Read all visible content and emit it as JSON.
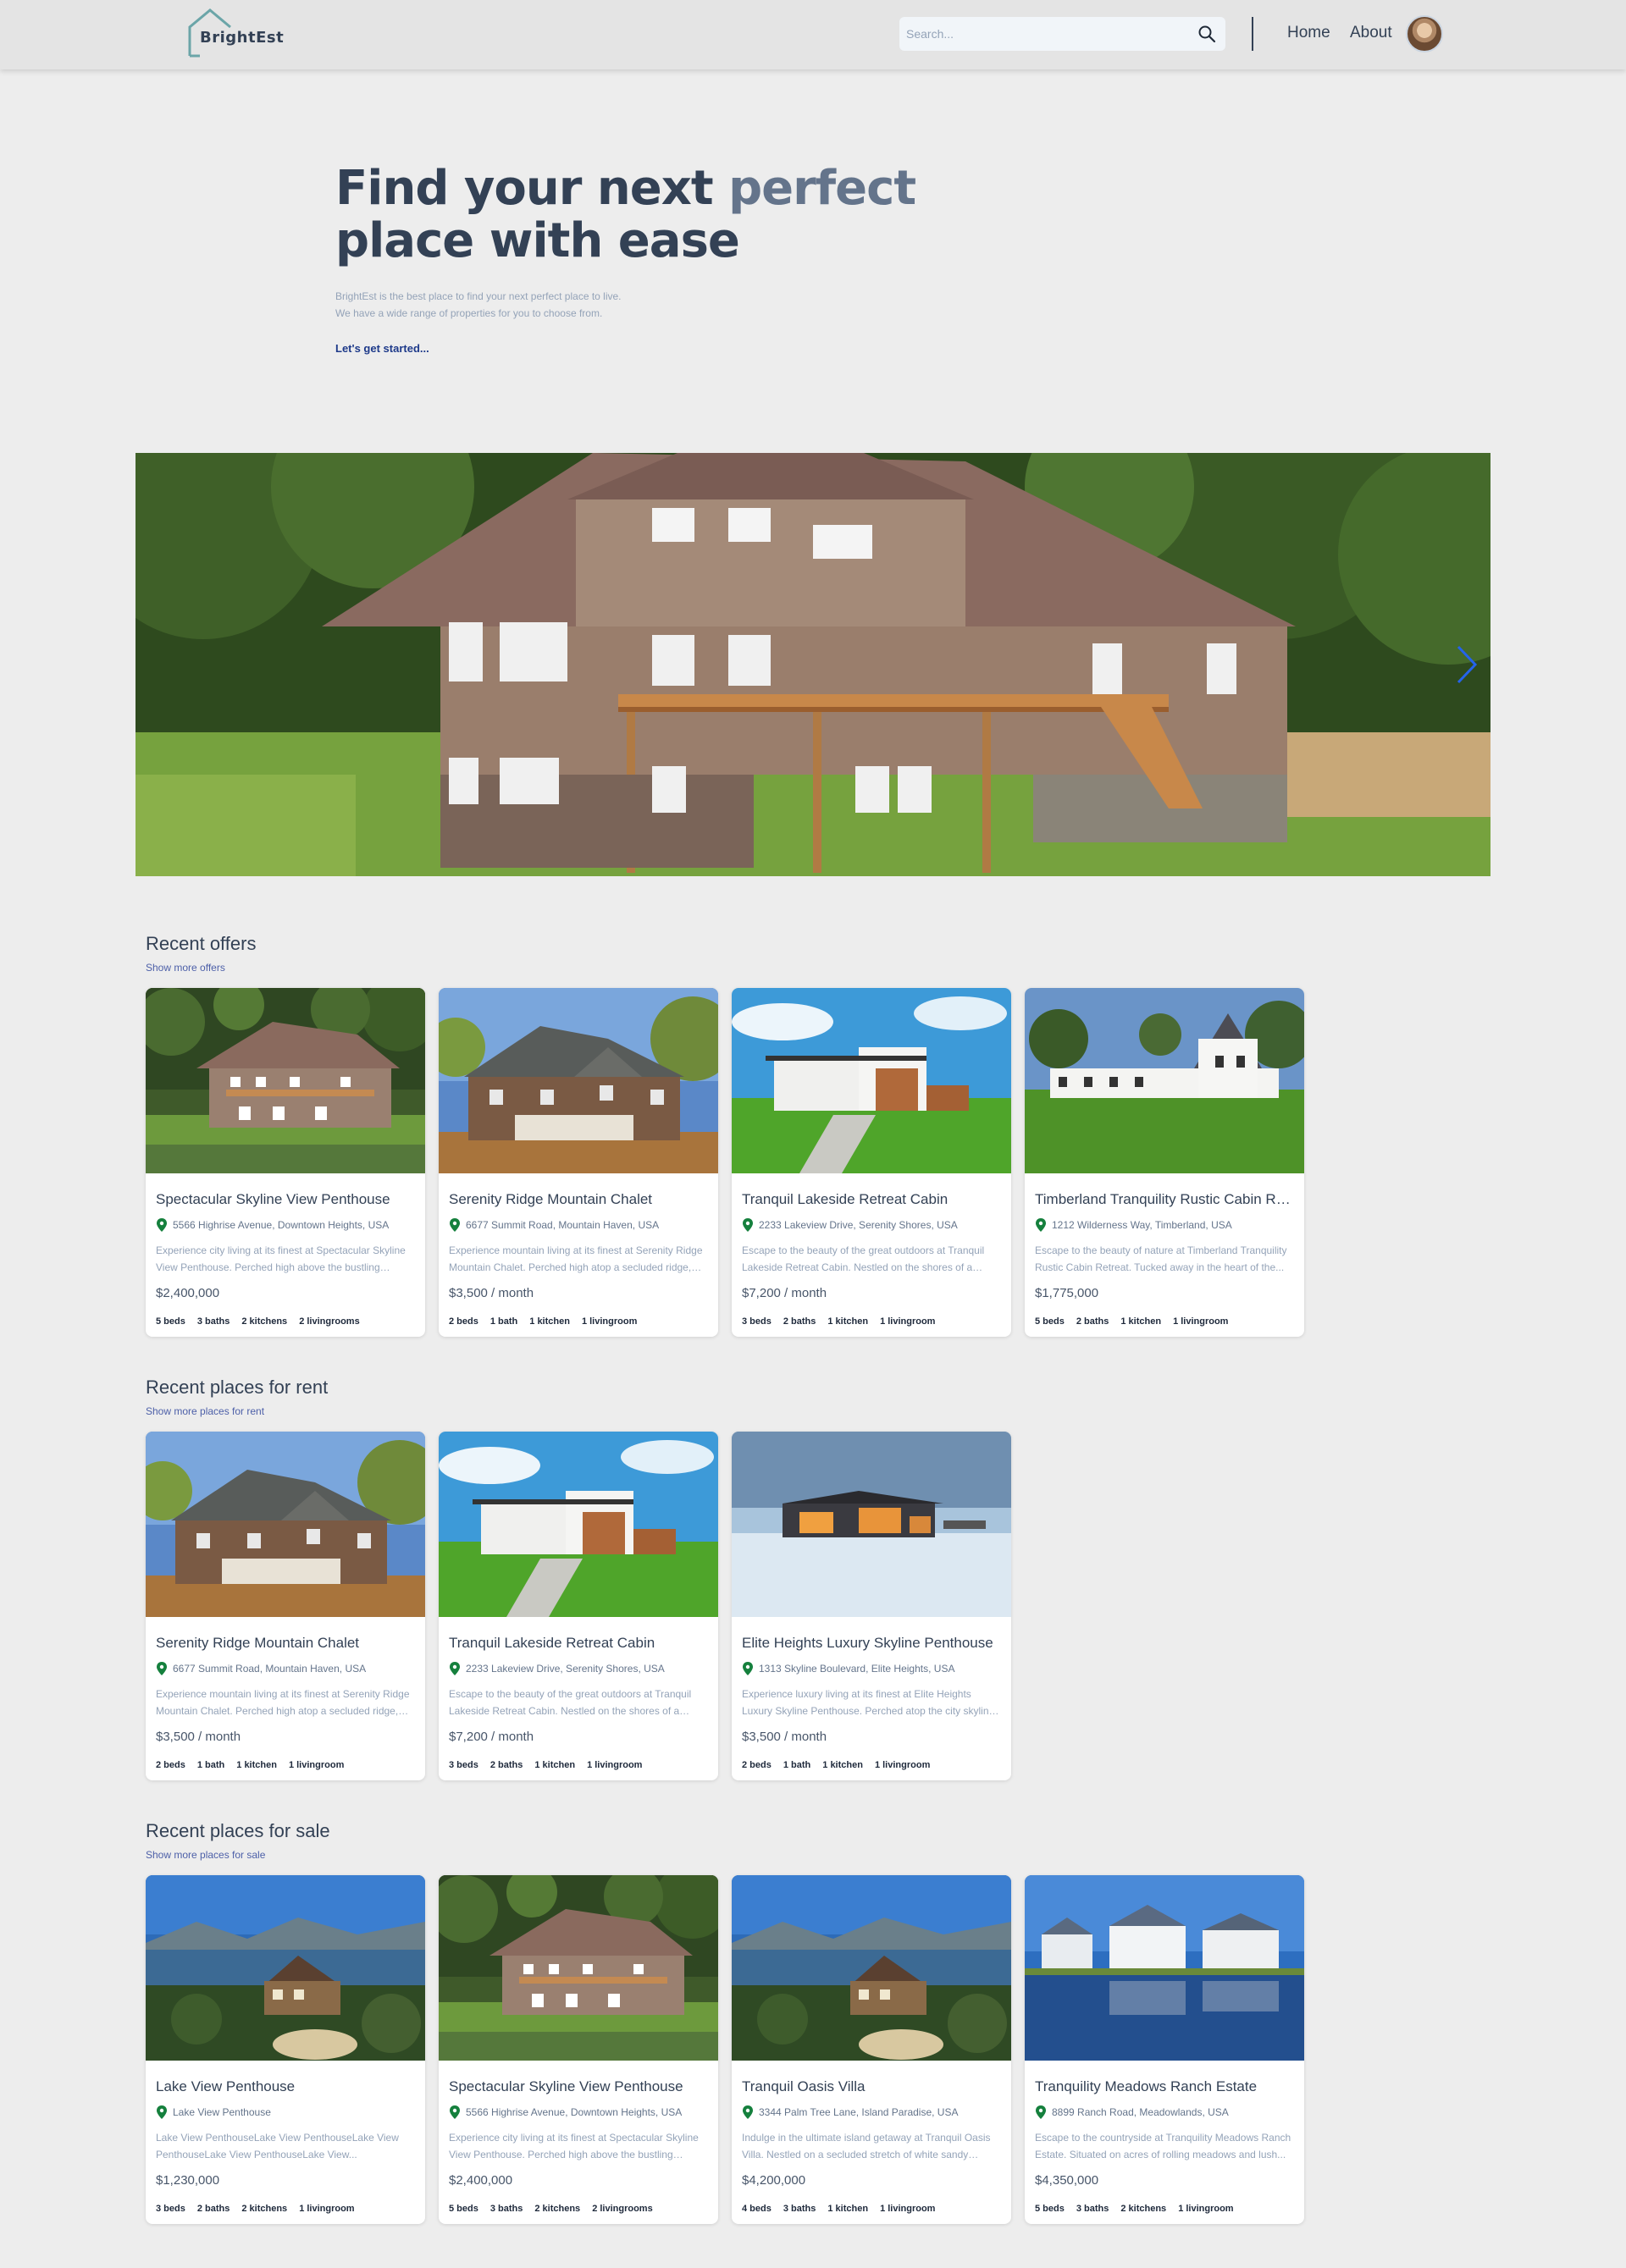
{
  "header": {
    "logo_text": "BrightEst",
    "search_placeholder": "Search...",
    "nav": {
      "home": "Home",
      "about": "About"
    }
  },
  "hero": {
    "title_part1": "Find your next ",
    "title_accent": "perfect",
    "title_part2": "place with ease",
    "subtitle_line1": "BrightEst is the best place to find your next perfect place to live.",
    "subtitle_line2": "We have a wide range of properties for you to choose from.",
    "cta": "Let's get started..."
  },
  "sections": {
    "offers": {
      "title": "Recent offers",
      "link": "Show more offers",
      "cards": [
        {
          "title": "Spectacular Skyline View Penthouse",
          "address": "5566 Highrise Avenue, Downtown Heights, USA",
          "description": "Experience city living at its finest at Spectacular Skyline View Penthouse. Perched high above the bustling street...",
          "price": "$2,400,000",
          "beds": "5 beds",
          "baths": "3 baths",
          "kitchens": "2 kitchens",
          "livingrooms": "2 livingrooms"
        },
        {
          "title": "Serenity Ridge Mountain Chalet",
          "address": "6677 Summit Road, Mountain Haven, USA",
          "description": "Experience mountain living at its finest at Serenity Ridge Mountain Chalet. Perched high atop a secluded ridge, thi...",
          "price": "$3,500 / month",
          "beds": "2 beds",
          "baths": "1 bath",
          "kitchens": "1 kitchen",
          "livingrooms": "1 livingroom"
        },
        {
          "title": "Tranquil Lakeside Retreat Cabin",
          "address": "2233 Lakeview Drive, Serenity Shores, USA",
          "description": "Escape to the beauty of the great outdoors at Tranquil Lakeside Retreat Cabin. Nestled on the shores of a pristi...",
          "price": "$7,200 / month",
          "beds": "3 beds",
          "baths": "2 baths",
          "kitchens": "1 kitchen",
          "livingrooms": "1 livingroom"
        },
        {
          "title": "Timberland Tranquility Rustic Cabin Retreat",
          "address": "1212 Wilderness Way, Timberland, USA",
          "description": "Escape to the beauty of nature at Timberland Tranquility Rustic Cabin Retreat. Tucked away in the heart of the...",
          "price": "$1,775,000",
          "beds": "5 beds",
          "baths": "2 baths",
          "kitchens": "1 kitchen",
          "livingrooms": "1 livingroom"
        }
      ]
    },
    "rent": {
      "title": "Recent places for rent",
      "link": "Show more places for rent",
      "cards": [
        {
          "title": "Serenity Ridge Mountain Chalet",
          "address": "6677 Summit Road, Mountain Haven, USA",
          "description": "Experience mountain living at its finest at Serenity Ridge Mountain Chalet. Perched high atop a secluded ridge, thi...",
          "price": "$3,500 / month",
          "beds": "2 beds",
          "baths": "1 bath",
          "kitchens": "1 kitchen",
          "livingrooms": "1 livingroom"
        },
        {
          "title": "Tranquil Lakeside Retreat Cabin",
          "address": "2233 Lakeview Drive, Serenity Shores, USA",
          "description": "Escape to the beauty of the great outdoors at Tranquil Lakeside Retreat Cabin. Nestled on the shores of a pristi...",
          "price": "$7,200 / month",
          "beds": "3 beds",
          "baths": "2 baths",
          "kitchens": "1 kitchen",
          "livingrooms": "1 livingroom"
        },
        {
          "title": "Elite Heights Luxury Skyline Penthouse",
          "address": "1313 Skyline Boulevard, Elite Heights, USA",
          "description": "Experience luxury living at its finest at Elite Heights Luxury Skyline Penthouse. Perched atop the city skyline, this...",
          "price": "$3,500 / month",
          "beds": "2 beds",
          "baths": "1 bath",
          "kitchens": "1 kitchen",
          "livingrooms": "1 livingroom"
        }
      ]
    },
    "sale": {
      "title": "Recent places for sale",
      "link": "Show more places for sale",
      "cards": [
        {
          "title": "Lake View Penthouse",
          "address": "Lake View Penthouse",
          "description": "Lake View PenthouseLake View PenthouseLake View PenthouseLake View PenthouseLake View...",
          "price": "$1,230,000",
          "beds": "3 beds",
          "baths": "2 baths",
          "kitchens": "2 kitchens",
          "livingrooms": "1 livingroom"
        },
        {
          "title": "Spectacular Skyline View Penthouse",
          "address": "5566 Highrise Avenue, Downtown Heights, USA",
          "description": "Experience city living at its finest at Spectacular Skyline View Penthouse. Perched high above the bustling street...",
          "price": "$2,400,000",
          "beds": "5 beds",
          "baths": "3 baths",
          "kitchens": "2 kitchens",
          "livingrooms": "2 livingrooms"
        },
        {
          "title": "Tranquil Oasis Villa",
          "address": "3344 Palm Tree Lane, Island Paradise, USA",
          "description": "Indulge in the ultimate island getaway at Tranquil Oasis Villa. Nestled on a secluded stretch of white sandy beach...",
          "price": "$4,200,000",
          "beds": "4 beds",
          "baths": "3 baths",
          "kitchens": "1 kitchen",
          "livingrooms": "1 livingroom"
        },
        {
          "title": "Tranquility Meadows Ranch Estate",
          "address": "8899 Ranch Road, Meadowlands, USA",
          "description": "Escape to the countryside at Tranquility Meadows Ranch Estate. Situated on acres of rolling meadows and lush...",
          "price": "$4,350,000",
          "beds": "5 beds",
          "baths": "3 baths",
          "kitchens": "2 kitchens",
          "livingrooms": "1 livingroom"
        }
      ]
    }
  },
  "colors": {
    "background": "#ededed",
    "header": "#e4e4e4",
    "text_dark": "#334155",
    "accent_muted": "#64748b",
    "link": "#4c5fa8",
    "pin": "#15803d"
  }
}
